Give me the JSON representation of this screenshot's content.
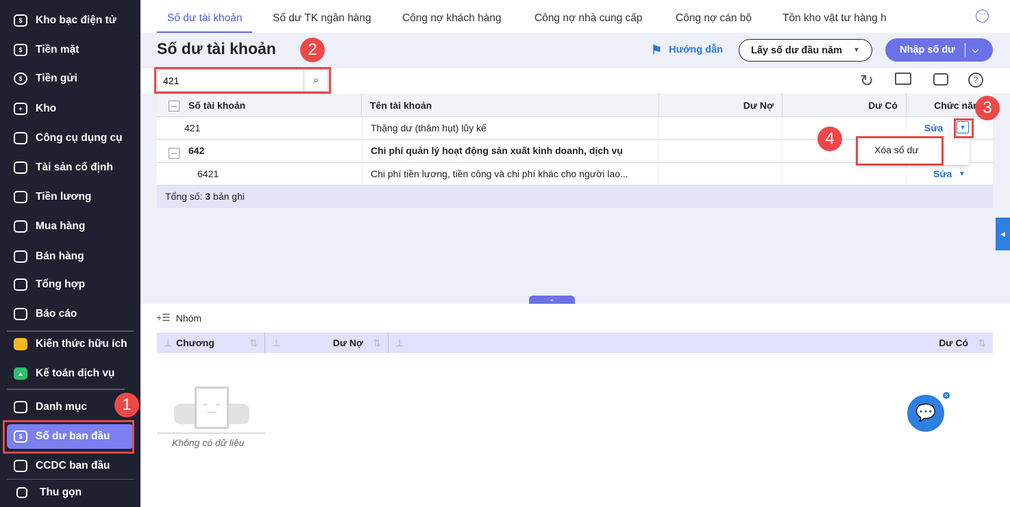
{
  "sidebar": {
    "items": [
      {
        "label": "Kho bạc điện tử",
        "icon": "treasury-icon"
      },
      {
        "label": "Tiền mặt",
        "icon": "cash-icon"
      },
      {
        "label": "Tiền gửi",
        "icon": "deposit-icon"
      },
      {
        "label": "Kho",
        "icon": "warehouse-icon"
      },
      {
        "label": "Công cụ dụng cụ",
        "icon": "tools-icon"
      },
      {
        "label": "Tài sản cố định",
        "icon": "truck-icon"
      },
      {
        "label": "Tiền lương",
        "icon": "salary-icon"
      },
      {
        "label": "Mua hàng",
        "icon": "cart-icon"
      },
      {
        "label": "Bán hàng",
        "icon": "store-icon"
      },
      {
        "label": "Tổng hợp",
        "icon": "summary-icon"
      },
      {
        "label": "Báo cáo",
        "icon": "report-icon"
      },
      {
        "label": "Kiến thức hữu ích",
        "icon": "knowledge-icon"
      },
      {
        "label": "Kế toán dịch vụ",
        "icon": "accounting-service-icon"
      },
      {
        "label": "Danh mục",
        "icon": "catalog-icon"
      },
      {
        "label": "Số dư ban đầu",
        "icon": "opening-balance-icon"
      },
      {
        "label": "CCDC ban đầu",
        "icon": "ccdc-icon"
      }
    ],
    "collapse": "Thu gọn"
  },
  "badges": [
    "1",
    "2",
    "3",
    "4"
  ],
  "tabs": [
    "Số dư tài khoản",
    "Số dư TK ngân hàng",
    "Công nợ khách hàng",
    "Công nợ nhà cung cấp",
    "Công nợ cán bộ",
    "Tồn kho vật tư hàng h"
  ],
  "header": {
    "title": "Số dư tài khoản",
    "guide": "Hướng dẫn",
    "get_balance": "Lấy số dư đầu năm",
    "import": "Nhập số dư"
  },
  "search": {
    "value": "421"
  },
  "table": {
    "columns": [
      "Số tài khoản",
      "Tên tài khoản",
      "Dư Nợ",
      "Dư Có",
      "Chức năng"
    ],
    "rows": [
      {
        "account": "421",
        "name": "Thặng dư (thâm hụt) lũy kế",
        "debit": "",
        "credit": "",
        "action": "Sửa"
      },
      {
        "account": "642",
        "name": "Chi phí quản lý hoạt động sản xuất kinh doanh, dịch vụ",
        "debit": "",
        "credit": "",
        "action": ""
      },
      {
        "account": "6421",
        "name": "Chi phí tiền lương, tiền công và chi phí khác cho người lao...",
        "debit": "",
        "credit": "",
        "action": "Sửa"
      }
    ],
    "footer_prefix": "Tổng số: ",
    "footer_count": "3",
    "footer_suffix": " bản ghi"
  },
  "dropdown": {
    "delete": "Xóa số dư"
  },
  "lower": {
    "group": "Nhóm",
    "columns": [
      "Chương",
      "Dư Nợ",
      "Dư Có"
    ],
    "empty": "Không có dữ liệu"
  },
  "colors": {
    "sidebar": "#1f2130",
    "active": "#7b7ff0",
    "primary": "#5b6ce0",
    "badge": "#f04848"
  }
}
